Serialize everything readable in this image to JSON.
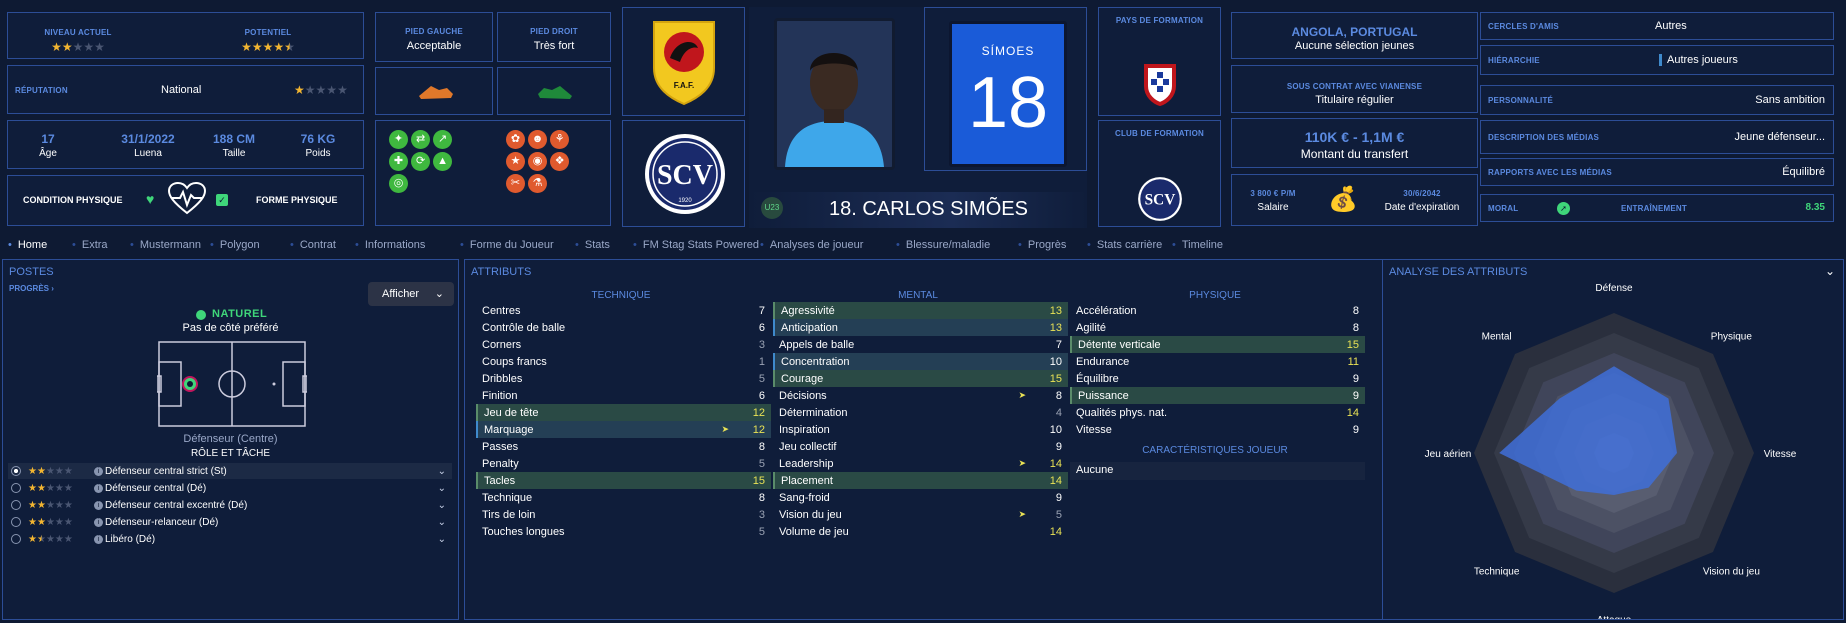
{
  "top": {
    "current_level_label": "NIVEAU ACTUEL",
    "potential_label": "POTENTIEL",
    "current_level_stars": 2,
    "potential_stars": 4.5,
    "reputation_label": "RÉPUTATION",
    "reputation_value": "National",
    "reputation_stars": 1,
    "age_value": "17",
    "age_label": "Âge",
    "joined_value": "31/1/2022",
    "joined_label": "Luena",
    "height_value": "188 CM",
    "height_label": "Taille",
    "weight_value": "76 KG",
    "weight_label": "Poids",
    "condition_label": "CONDITION PHYSIQUE",
    "form_label": "FORME PHYSIQUE",
    "left_foot_label": "PIED GAUCHE",
    "left_foot_value": "Acceptable",
    "right_foot_label": "PIED DROIT",
    "right_foot_value": "Très fort",
    "kit_name": "SÍMOES",
    "kit_number": "18",
    "player_name": "18. CARLOS SIMÕES",
    "u23_badge": "U23",
    "training_country_label": "PAYS DE FORMATION",
    "training_club_label": "CLUB DE FORMATION",
    "nationality": "ANGOLA, PORTUGAL",
    "nationality_sub": "Aucune sélection jeunes",
    "contract_label": "SOUS CONTRAT AVEC VIANENSE",
    "contract_value": "Titulaire régulier",
    "transfer_value": "110K € - 1,1M €",
    "transfer_label": "Montant du transfert",
    "salary_value": "3 800 € P/M",
    "salary_label": "Salaire",
    "expiry_value": "30/6/2042",
    "expiry_label": "Date d'expiration",
    "friends_label": "CERCLES D'AMIS",
    "friends_value": "Autres",
    "hierarchy_label": "HIÉRARCHIE",
    "hierarchy_value": "Autres joueurs",
    "personality_label": "PERSONNALITÉ",
    "personality_value": "Sans ambition",
    "media_label": "DESCRIPTION DES MÉDIAS",
    "media_value": "Jeune défenseur...",
    "media_rel_label": "RAPPORTS AVEC LES MÉDIAS",
    "media_rel_value": "Équilibré",
    "morale_label": "MORAL",
    "training_label": "ENTRAÎNEMENT",
    "training_value": "8.35"
  },
  "tabs": [
    "Home",
    "Extra",
    "Mustermann",
    "Polygon",
    "Contrat",
    "Informations",
    "Forme du Joueur",
    "Stats",
    "FM Stag Stats Powered",
    "Analyses de joueur",
    "Blessure/maladie",
    "Progrès",
    "Stats carrière",
    "Timeline"
  ],
  "positions": {
    "title": "POSTES",
    "progress_link": "PROGRÈS",
    "show_button": "Afficher",
    "natural_label": "NATUREL",
    "side_pref": "Pas de côté préféré",
    "position_name": "Défenseur (Centre)",
    "role_title": "RÔLE ET TÂCHE",
    "roles": [
      {
        "name": "Défenseur central strict (St)",
        "stars": 2
      },
      {
        "name": "Défenseur central (Dé)",
        "stars": 2
      },
      {
        "name": "Défenseur central excentré (Dé)",
        "stars": 2
      },
      {
        "name": "Défenseur-relanceur (Dé)",
        "stars": 2
      },
      {
        "name": "Libéro (Dé)",
        "stars": 1.5
      }
    ]
  },
  "attributes": {
    "title": "ATTRIBUTS",
    "technical_title": "TECHNIQUE",
    "mental_title": "MENTAL",
    "physical_title": "PHYSIQUE",
    "traits_title": "CARACTÉRISTIQUES JOUEUR",
    "traits_value": "Aucune",
    "technical": [
      {
        "n": "Centres",
        "v": "7",
        "c": "w",
        "h": ""
      },
      {
        "n": "Contrôle de balle",
        "v": "6",
        "c": "w",
        "h": ""
      },
      {
        "n": "Corners",
        "v": "3",
        "c": "gr",
        "h": ""
      },
      {
        "n": "Coups francs",
        "v": "1",
        "c": "gr",
        "h": ""
      },
      {
        "n": "Dribbles",
        "v": "5",
        "c": "gr",
        "h": ""
      },
      {
        "n": "Finition",
        "v": "6",
        "c": "w",
        "h": ""
      },
      {
        "n": "Jeu de tête",
        "v": "12",
        "c": "y",
        "h": "hg"
      },
      {
        "n": "Marquage",
        "v": "12",
        "c": "y",
        "h": "hi",
        "arrow": true
      },
      {
        "n": "Passes",
        "v": "8",
        "c": "w",
        "h": ""
      },
      {
        "n": "Penalty",
        "v": "5",
        "c": "gr",
        "h": ""
      },
      {
        "n": "Tacles",
        "v": "15",
        "c": "y",
        "h": "hg"
      },
      {
        "n": "Technique",
        "v": "8",
        "c": "w",
        "h": ""
      },
      {
        "n": "Tirs de loin",
        "v": "3",
        "c": "gr",
        "h": ""
      },
      {
        "n": "Touches longues",
        "v": "5",
        "c": "gr",
        "h": ""
      }
    ],
    "mental": [
      {
        "n": "Agressivité",
        "v": "13",
        "c": "y",
        "h": "hg"
      },
      {
        "n": "Anticipation",
        "v": "13",
        "c": "y",
        "h": "hi"
      },
      {
        "n": "Appels de balle",
        "v": "7",
        "c": "w",
        "h": ""
      },
      {
        "n": "Concentration",
        "v": "10",
        "c": "w",
        "h": "hi"
      },
      {
        "n": "Courage",
        "v": "15",
        "c": "y",
        "h": "hg"
      },
      {
        "n": "Décisions",
        "v": "8",
        "c": "w",
        "h": "",
        "arrow": true
      },
      {
        "n": "Détermination",
        "v": "4",
        "c": "gr",
        "h": ""
      },
      {
        "n": "Inspiration",
        "v": "10",
        "c": "w",
        "h": ""
      },
      {
        "n": "Jeu collectif",
        "v": "9",
        "c": "w",
        "h": ""
      },
      {
        "n": "Leadership",
        "v": "14",
        "c": "y",
        "h": "",
        "arrow": true
      },
      {
        "n": "Placement",
        "v": "14",
        "c": "y",
        "h": "hg"
      },
      {
        "n": "Sang-froid",
        "v": "9",
        "c": "w",
        "h": ""
      },
      {
        "n": "Vision du jeu",
        "v": "5",
        "c": "gr",
        "h": "",
        "arrow": true
      },
      {
        "n": "Volume de jeu",
        "v": "14",
        "c": "y",
        "h": ""
      }
    ],
    "physical": [
      {
        "n": "Accélération",
        "v": "8",
        "c": "w",
        "h": ""
      },
      {
        "n": "Agilité",
        "v": "8",
        "c": "w",
        "h": ""
      },
      {
        "n": "Détente verticale",
        "v": "15",
        "c": "y",
        "h": "hg"
      },
      {
        "n": "Endurance",
        "v": "11",
        "c": "y",
        "h": ""
      },
      {
        "n": "Équilibre",
        "v": "9",
        "c": "w",
        "h": ""
      },
      {
        "n": "Puissance",
        "v": "9",
        "c": "w",
        "h": "hg"
      },
      {
        "n": "Qualités phys. nat.",
        "v": "14",
        "c": "y",
        "h": ""
      },
      {
        "n": "Vitesse",
        "v": "9",
        "c": "w",
        "h": ""
      }
    ]
  },
  "analysis": {
    "title": "ANALYSE DES ATTRIBUTS",
    "axes": [
      "Défense",
      "Physique",
      "Vitesse",
      "Vision du jeu",
      "Attaque",
      "Technique",
      "Jeu aérien",
      "Mental"
    ],
    "values": [
      0.62,
      0.55,
      0.45,
      0.35,
      0.3,
      0.38,
      0.82,
      0.55
    ]
  },
  "colors": {
    "accent": "#5b8ae0",
    "star": "#f2b531",
    "highlight": "#e9e255",
    "green": "#3fb83f"
  }
}
